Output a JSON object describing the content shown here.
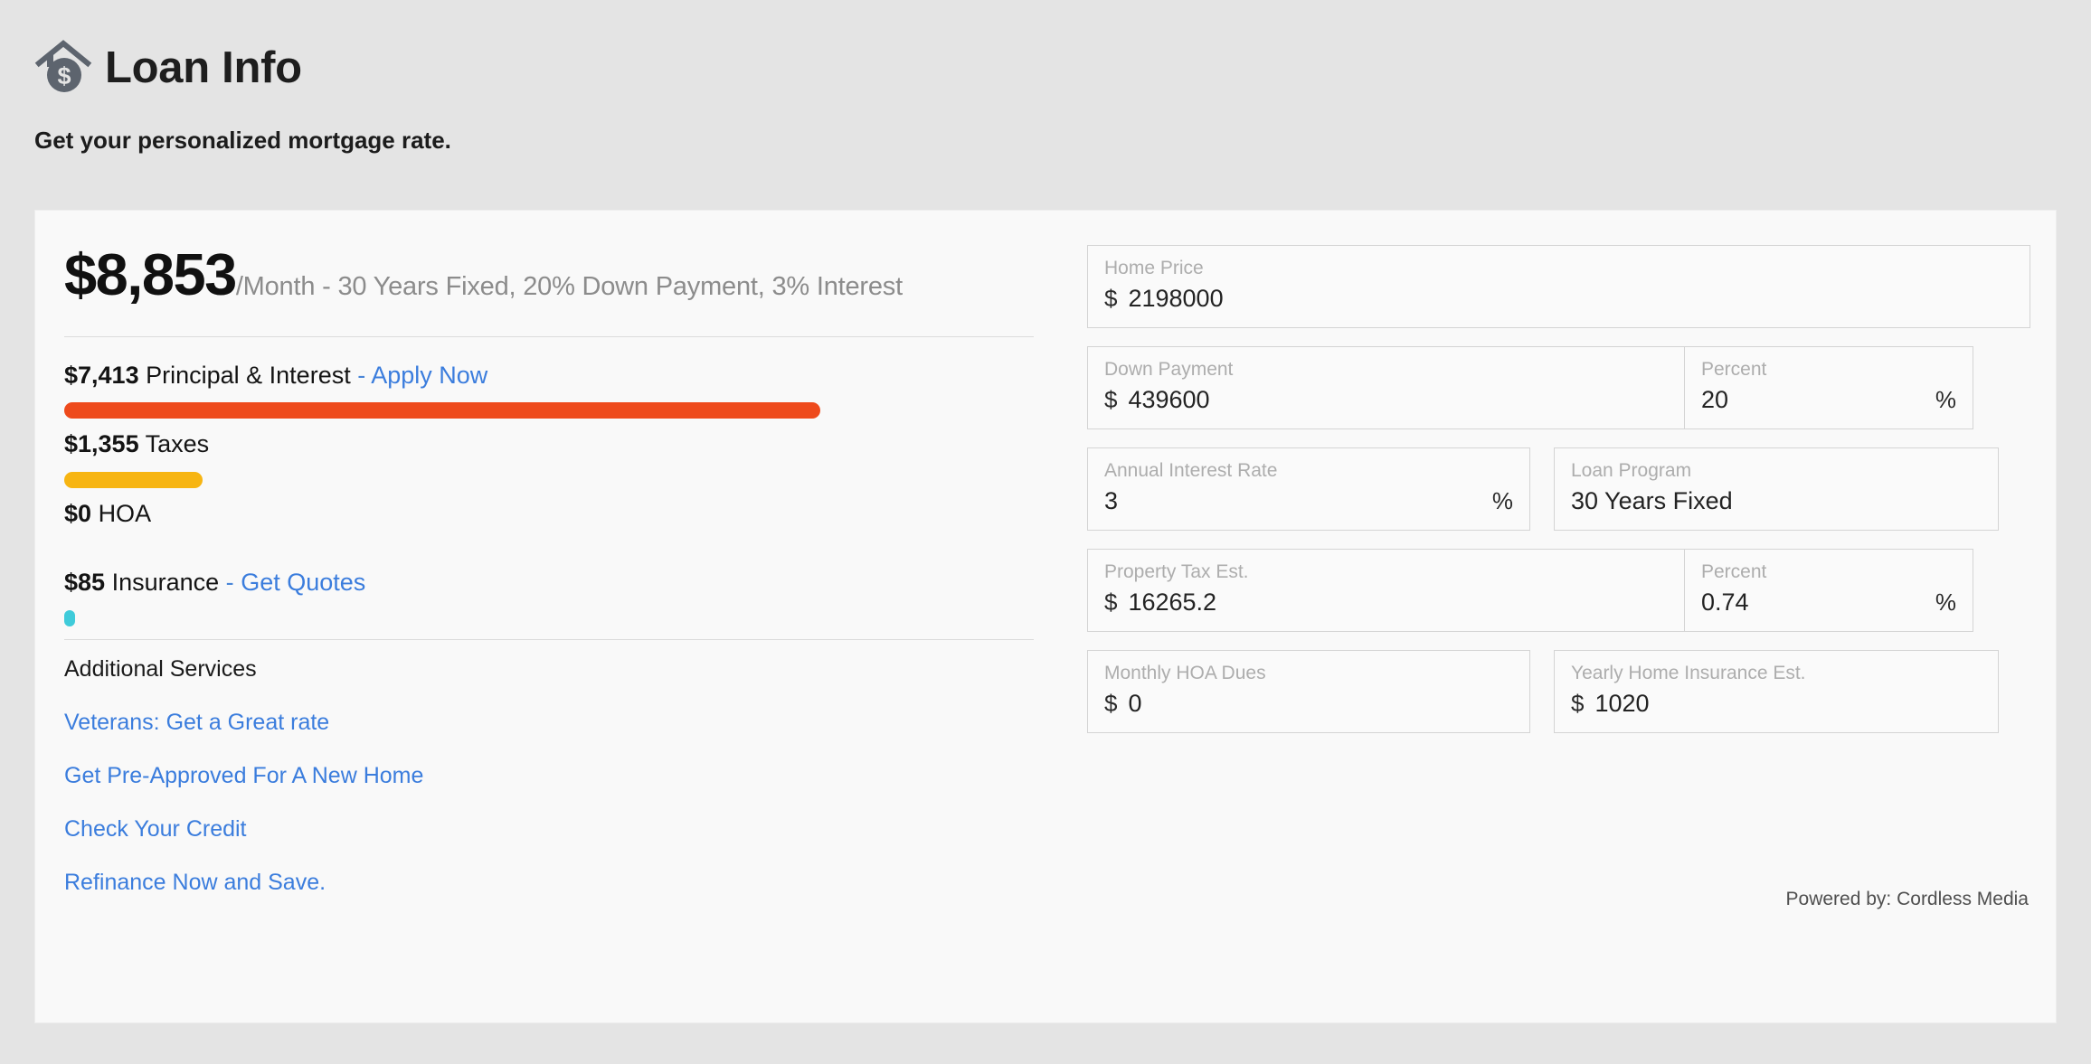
{
  "header": {
    "icon": "house-dollar-icon",
    "title": "Loan Info",
    "subtitle": "Get your personalized mortgage rate."
  },
  "summary": {
    "amount": "$8,853",
    "terms": "/Month - 30 Years Fixed, 20% Down Payment, 3% Interest"
  },
  "breakdown": {
    "rows": [
      {
        "value": "$7,413",
        "label": "Principal & Interest",
        "dash": "-",
        "link": "Apply Now",
        "bar_color": "#EE4A1C",
        "bar_percent": 78
      },
      {
        "value": "$1,355",
        "label": "Taxes",
        "dash": "",
        "link": "",
        "bar_color": "#F7B512",
        "bar_percent": 14.3
      },
      {
        "value": "$0",
        "label": "HOA",
        "dash": "",
        "link": "",
        "bar_color": "",
        "bar_percent": 0
      },
      {
        "value": "$85",
        "label": "Insurance",
        "dash": "-",
        "link": "Get Quotes",
        "bar_color": "#3FCBDA",
        "bar_percent": 1.1
      }
    ]
  },
  "services": {
    "title": "Additional Services",
    "links": [
      "Veterans: Get a Great rate",
      "Get Pre-Approved For A New Home",
      "Check Your Credit",
      "Refinance Now and Save."
    ]
  },
  "form": {
    "home_price": {
      "label": "Home Price",
      "currency": "$",
      "value": "2198000"
    },
    "down_payment": {
      "label": "Down Payment",
      "currency": "$",
      "value": "439600"
    },
    "down_percent": {
      "label": "Percent",
      "value": "20",
      "suffix": "%"
    },
    "interest_rate": {
      "label": "Annual Interest Rate",
      "value": "3",
      "suffix": "%"
    },
    "loan_program": {
      "label": "Loan Program",
      "value": "30 Years Fixed"
    },
    "property_tax": {
      "label": "Property Tax Est.",
      "currency": "$",
      "value": "16265.2"
    },
    "tax_percent": {
      "label": "Percent",
      "value": "0.74",
      "suffix": "%"
    },
    "hoa_dues": {
      "label": "Monthly HOA Dues",
      "currency": "$",
      "value": "0"
    },
    "home_insurance": {
      "label": "Yearly Home Insurance Est.",
      "currency": "$",
      "value": "1020"
    }
  },
  "footer": {
    "powered_by": "Powered by: Cordless Media"
  },
  "colors": {
    "principal": "#EE4A1C",
    "taxes": "#F7B512",
    "insurance": "#3FCBDA",
    "link": "#3b7ddd"
  }
}
